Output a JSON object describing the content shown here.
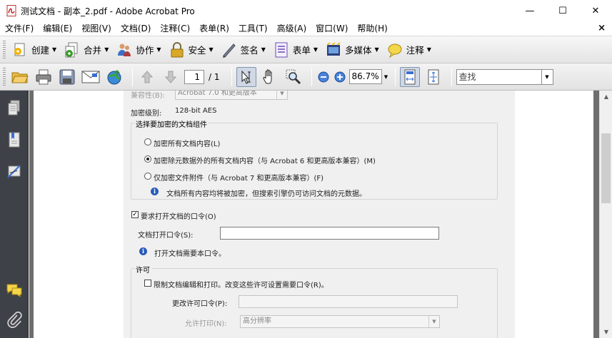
{
  "window": {
    "title": "测试文档 - 副本_2.pdf - Adobe Acrobat Pro",
    "minimize": "—",
    "maximize": "☐",
    "close": "✕"
  },
  "menu": {
    "items": [
      "文件(F)",
      "编辑(E)",
      "视图(V)",
      "文档(D)",
      "注释(C)",
      "表单(R)",
      "工具(T)",
      "高级(A)",
      "窗口(W)",
      "帮助(H)"
    ],
    "close_doc": "×"
  },
  "tasks": {
    "create": "创建",
    "combine": "合并",
    "collaborate": "协作",
    "secure": "安全",
    "sign": "签名",
    "forms": "表单",
    "multimedia": "多媒体",
    "comment": "注释"
  },
  "toolbar": {
    "page_current": "1",
    "page_total": "/ 1",
    "zoom": "86.7%",
    "search_placeholder": "查找"
  },
  "dialog": {
    "compat_label": "兼容性(B):",
    "compat_value": "Acrobat 7.0 和更高版本",
    "encrypt_level_label": "加密级别:",
    "encrypt_level_value": "128-bit AES",
    "group_select_title": "选择要加密的文档组件",
    "opt_all": "加密所有文档内容(L)",
    "opt_except_meta": "加密除元数据外的所有文档内容（与 Acrobat 6 和更高版本兼容）(M)",
    "opt_attach": "仅加密文件附件（与 Acrobat 7 和更高版本兼容）(F)",
    "info_all": "文档所有内容均将被加密，但搜索引擎仍可访问文档的元数据。",
    "require_open_pw": "要求打开文档的口令(O)",
    "open_pw_label": "文档打开口令(S):",
    "open_pw_info": "打开文档需要本口令。",
    "perm_title": "许可",
    "restrict_label": "限制文档编辑和打印。改变这些许可设置需要口令(R)。",
    "change_pw_label": "更改许可口令(P):",
    "print_allowed_label": "允许打印(N):",
    "print_allowed_value": "高分辨率"
  },
  "colors": {
    "nav_bg": "#3e4148",
    "doc_bg": "#6e6e6e",
    "info_blue": "#2a5cb8"
  }
}
